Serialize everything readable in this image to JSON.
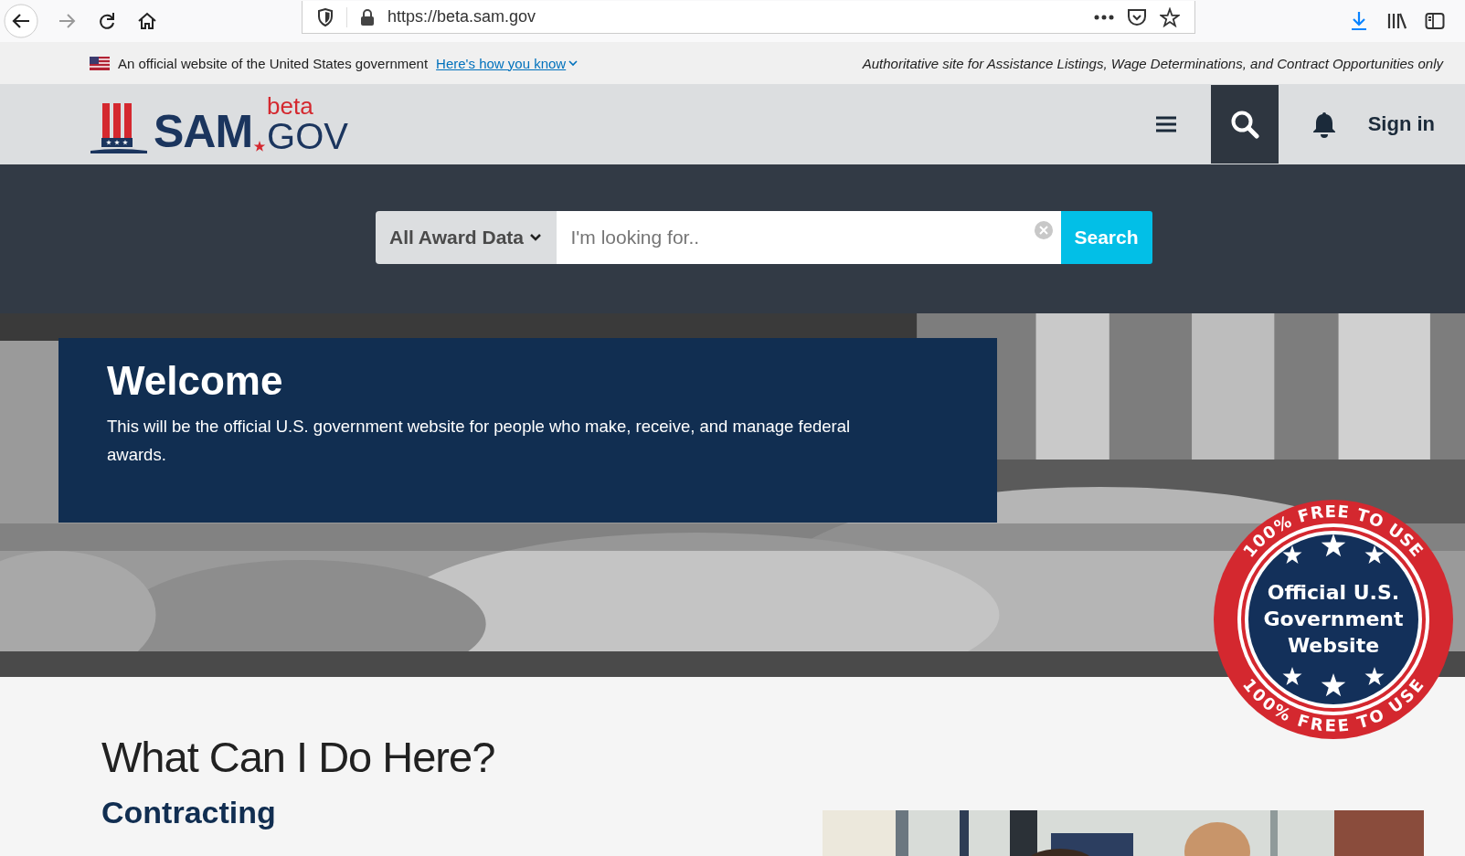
{
  "browser": {
    "url": "https://beta.sam.gov"
  },
  "gov_banner": {
    "text": "An official website of the United States government",
    "link": "Here's how you know",
    "tagline": "Authoritative site for Assistance Listings, Wage Determinations, and Contract Opportunities only"
  },
  "header": {
    "logo": {
      "name": "SAM",
      "badge": "beta",
      "suffix": "GOV"
    },
    "sign_in": "Sign in"
  },
  "search": {
    "scope": "All Award Data",
    "placeholder": "I'm looking for..",
    "button": "Search"
  },
  "hero": {
    "kind": "picture",
    "title": "Welcome",
    "text": "This will be the official U.S. government website for people who make, receive, and manage federal awards."
  },
  "seal": {
    "ring_top": "100% FREE TO USE",
    "ring_bottom": "100% FREE TO USE",
    "lines": [
      "Official U.S.",
      "Government",
      "Website"
    ]
  },
  "section": {
    "title": "What Can I Do Here?",
    "subtitle": "Contracting"
  }
}
